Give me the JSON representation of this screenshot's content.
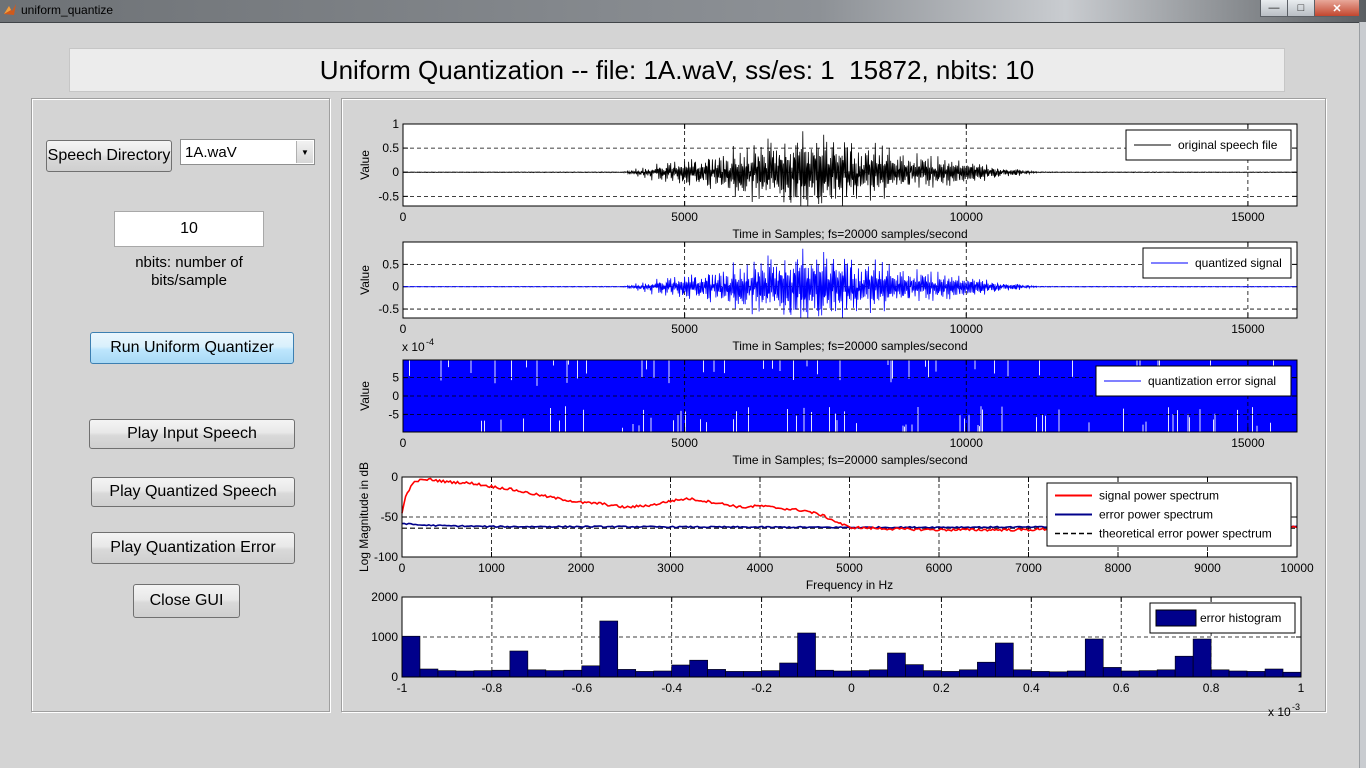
{
  "window": {
    "title": "uniform_quantize",
    "controls": [
      "minimize",
      "maximize",
      "close"
    ]
  },
  "header": {
    "text": "Uniform Quantization -- file: 1A.waV, ss/es: 1  15872, nbits: 10"
  },
  "controls": {
    "speech_directory_label": "Speech Directory",
    "file_select": {
      "selected": "1A.waV"
    },
    "nbits_value": "10",
    "nbits_label_line1": "nbits: number of",
    "nbits_label_line2": "bits/sample",
    "run_label": "Run Uniform Quantizer",
    "play_input_label": "Play Input Speech",
    "play_quantized_label": "Play Quantized Speech",
    "play_error_label": "Play Quantization Error",
    "close_label": "Close GUI"
  },
  "colors": {
    "original": "#000000",
    "quantized": "#0000ff",
    "error": "#0000ff",
    "signal_spectrum": "#ff0000",
    "error_spectrum": "#00008b",
    "histogram": "#00008b"
  },
  "chart_data": [
    {
      "type": "line",
      "name": "original",
      "xlabel": "Time in Samples; fs=20000 samples/second",
      "ylabel": "Value",
      "xlim": [
        0,
        15872
      ],
      "ylim": [
        -0.7,
        1
      ],
      "xticks": [
        "0",
        "5000",
        "10000",
        "15000"
      ],
      "yticks": [
        "1",
        "0.5",
        "0",
        "-0.5"
      ],
      "grid": true,
      "legend": "top-right",
      "series": [
        {
          "name": "original speech file",
          "envelope_x": [
            0,
            3900,
            4500,
            5500,
            6500,
            7000,
            7500,
            8500,
            9500,
            10500,
            11300,
            15872
          ],
          "envelope_y": [
            0.005,
            0.01,
            0.2,
            0.45,
            0.75,
            1.0,
            0.85,
            0.6,
            0.35,
            0.15,
            0.01,
            0.005
          ]
        }
      ]
    },
    {
      "type": "line",
      "name": "quantized",
      "xlabel": "Time in Samples; fs=20000 samples/second",
      "ylabel": "Value",
      "xlim": [
        0,
        15872
      ],
      "ylim": [
        -0.7,
        1
      ],
      "xticks": [
        "0",
        "5000",
        "10000",
        "15000"
      ],
      "yticks": [
        "0.5",
        "0",
        "-0.5"
      ],
      "grid": true,
      "legend": "top-right",
      "series": [
        {
          "name": "quantized signal",
          "envelope_x": [
            0,
            3900,
            4500,
            5500,
            6500,
            7000,
            7500,
            8500,
            9500,
            10500,
            11300,
            15872
          ],
          "envelope_y": [
            0.005,
            0.01,
            0.2,
            0.45,
            0.75,
            1.0,
            0.85,
            0.6,
            0.35,
            0.15,
            0.01,
            0.005
          ]
        }
      ]
    },
    {
      "type": "line",
      "name": "error",
      "xlabel": "Time in Samples; fs=20000 samples/second",
      "ylabel": "Value",
      "xlim": [
        0,
        15872
      ],
      "ylim": [
        -9.8,
        9.8
      ],
      "scale_label": "x 10",
      "scale_exponent": "-4",
      "xticks": [
        "0",
        "5000",
        "10000",
        "15000"
      ],
      "yticks": [
        "5",
        "0",
        "-5"
      ],
      "grid": true,
      "legend": "top-right",
      "series": [
        {
          "name": "quantization error signal",
          "amplitude": 9.77
        }
      ]
    },
    {
      "type": "line",
      "name": "spectrum",
      "xlabel": "Frequency in Hz",
      "ylabel": "Log Magnitude in dB",
      "xlim": [
        0,
        10000
      ],
      "ylim": [
        -100,
        0
      ],
      "xticks": [
        "0",
        "1000",
        "2000",
        "3000",
        "4000",
        "5000",
        "6000",
        "7000",
        "8000",
        "9000",
        "10000"
      ],
      "yticks": [
        "0",
        "-50",
        "-100"
      ],
      "grid": true,
      "legend": "top-right",
      "series": [
        {
          "name": "signal power spectrum",
          "x": [
            0,
            50,
            150,
            300,
            500,
            800,
            1000,
            1200,
            1500,
            1800,
            2000,
            2200,
            2500,
            2800,
            3000,
            3200,
            3500,
            3800,
            4000,
            4300,
            4500,
            4700,
            4850,
            5000,
            5500,
            6000,
            7000,
            7500,
            8000,
            8500,
            9000,
            9500,
            10000
          ],
          "y": [
            -45,
            -20,
            -5,
            -3,
            -6,
            -8,
            -12,
            -15,
            -22,
            -28,
            -32,
            -33,
            -38,
            -35,
            -30,
            -27,
            -32,
            -38,
            -36,
            -40,
            -42,
            -48,
            -56,
            -63,
            -65,
            -66,
            -66,
            -64,
            -63,
            -64,
            -64,
            -63,
            -63
          ]
        },
        {
          "name": "error power spectrum",
          "x": [
            0,
            200,
            500,
            1000,
            2000,
            5000,
            10000
          ],
          "y": [
            -58,
            -60,
            -61,
            -62,
            -62,
            -63,
            -62
          ]
        },
        {
          "name": "theoretical error power spectrum",
          "x": [
            0,
            10000
          ],
          "y": [
            -64,
            -64
          ]
        }
      ]
    },
    {
      "type": "bar",
      "name": "histogram",
      "xlim": [
        -1,
        1
      ],
      "ylim": [
        0,
        2000
      ],
      "scale_label": "x 10",
      "scale_exponent": "-3",
      "xticks": [
        "-1",
        "-0.8",
        "-0.6",
        "-0.4",
        "-0.2",
        "0",
        "0.2",
        "0.4",
        "0.6",
        "0.8",
        "1"
      ],
      "yticks": [
        "2000",
        "1000",
        "0"
      ],
      "grid": true,
      "legend": "top-right",
      "series": [
        {
          "name": "error histogram",
          "bin_width": 0.04,
          "values": [
            1020,
            200,
            160,
            150,
            160,
            170,
            650,
            180,
            160,
            170,
            280,
            1400,
            190,
            140,
            150,
            300,
            420,
            190,
            140,
            140,
            160,
            350,
            1100,
            170,
            150,
            160,
            180,
            600,
            310,
            160,
            140,
            180,
            370,
            850,
            180,
            140,
            130,
            150,
            950,
            240,
            150,
            160,
            180,
            520,
            950,
            180,
            150,
            140,
            200,
            120
          ]
        }
      ]
    }
  ]
}
